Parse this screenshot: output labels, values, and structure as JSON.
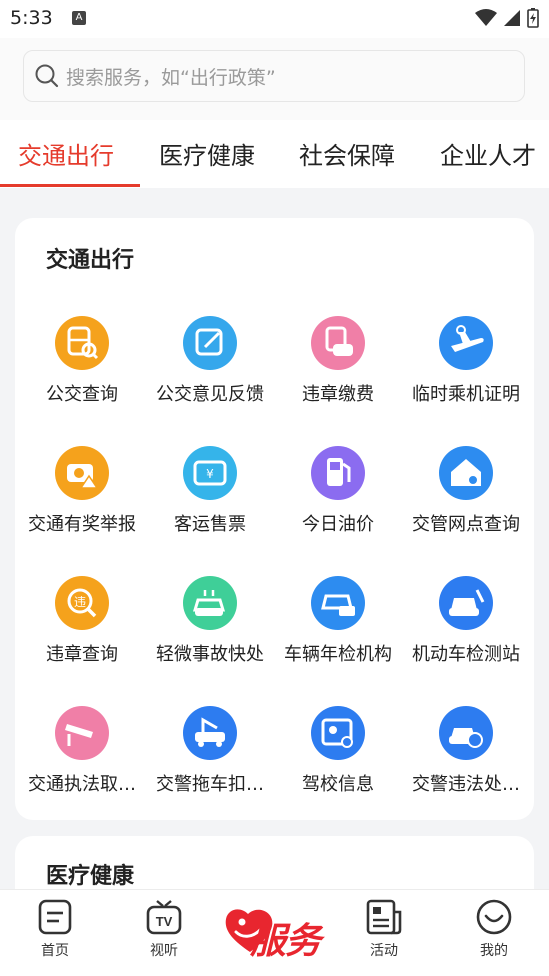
{
  "status": {
    "time": "5:33",
    "a_badge": "A"
  },
  "search": {
    "placeholder": "搜索服务，如“出行政策”"
  },
  "tabs": [
    {
      "label": "交通出行",
      "active": true
    },
    {
      "label": "医疗健康",
      "active": false
    },
    {
      "label": "社会保障",
      "active": false
    },
    {
      "label": "企业人才",
      "active": false
    }
  ],
  "sections": [
    {
      "title": "交通出行",
      "items": [
        {
          "label": "公交查询",
          "icon": "bus-search-icon",
          "color": "#f5a21c"
        },
        {
          "label": "公交意见反馈",
          "icon": "edit-feedback-icon",
          "color": "#35a7ec"
        },
        {
          "label": "违章缴费",
          "icon": "car-ticket-icon",
          "color": "#f07fa7"
        },
        {
          "label": "临时乘机证明",
          "icon": "airplane-icon",
          "color": "#2d8cf0"
        },
        {
          "label": "交通有奖举报",
          "icon": "camera-report-icon",
          "color": "#f5a21c"
        },
        {
          "label": "客运售票",
          "icon": "ticket-icon",
          "color": "#35b4ea"
        },
        {
          "label": "今日油价",
          "icon": "fuel-pump-icon",
          "color": "#8b6cf0"
        },
        {
          "label": "交管网点查询",
          "icon": "office-search-icon",
          "color": "#2d8cf0"
        },
        {
          "label": "违章查询",
          "icon": "violation-search-icon",
          "color": "#f5a21c"
        },
        {
          "label": "轻微事故快处",
          "icon": "accident-car-icon",
          "color": "#3fcf98"
        },
        {
          "label": "车辆年检机构",
          "icon": "car-inspection-icon",
          "color": "#2d8cf0"
        },
        {
          "label": "机动车检测站",
          "icon": "car-repair-icon",
          "color": "#2d7cf0"
        },
        {
          "label": "交通执法取…",
          "icon": "surveillance-camera-icon",
          "color": "#f07fa7"
        },
        {
          "label": "交警拖车扣…",
          "icon": "tow-truck-icon",
          "color": "#2d7cf0"
        },
        {
          "label": "驾校信息",
          "icon": "driving-school-icon",
          "color": "#2d7cf0"
        },
        {
          "label": "交警违法处…",
          "icon": "police-car-icon",
          "color": "#2d7cf0"
        }
      ]
    },
    {
      "title": "医疗健康"
    }
  ],
  "bottom_nav": [
    {
      "label": "首页",
      "icon": "home-doc-icon"
    },
    {
      "label": "视听",
      "icon": "tv-icon"
    },
    {
      "label": "服务",
      "icon": "service-heart-icon"
    },
    {
      "label": "活动",
      "icon": "newspaper-icon"
    },
    {
      "label": "我的",
      "icon": "smile-icon"
    }
  ],
  "colors": {
    "accent": "#e53b2c",
    "service_red": "#e8262f"
  }
}
